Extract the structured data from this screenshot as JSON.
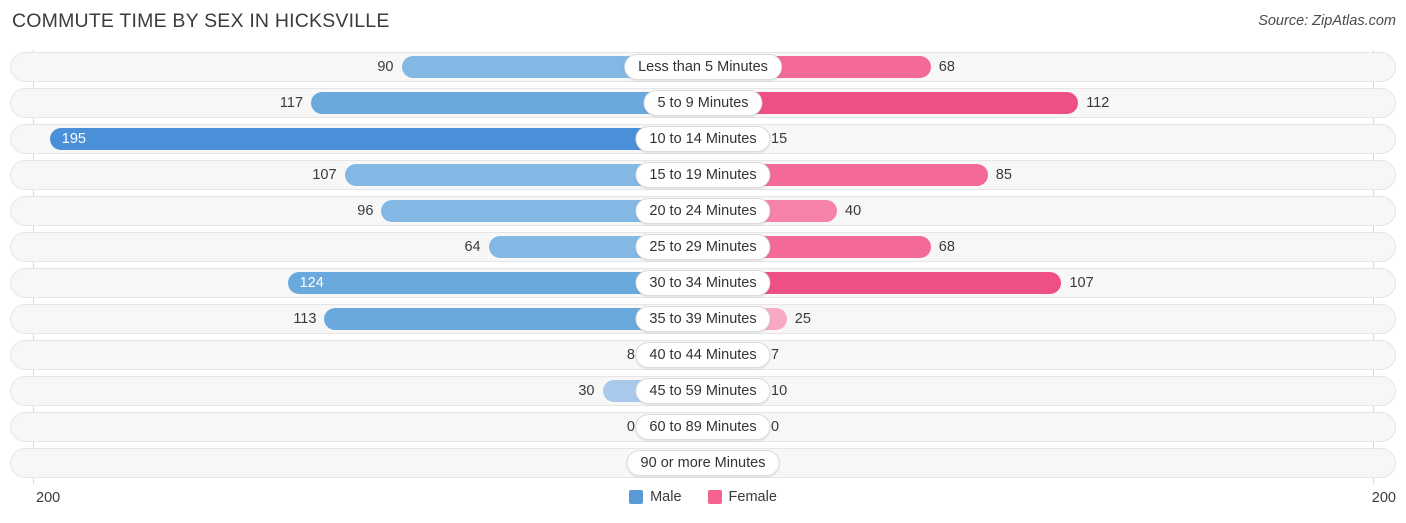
{
  "header": {
    "title": "COMMUTE TIME BY SEX IN HICKSVILLE",
    "source": "Source: ZipAtlas.com"
  },
  "axis": {
    "left_label": "200",
    "right_label": "200",
    "max": 200
  },
  "legend": {
    "items": [
      {
        "label": "Male",
        "color": "#5b9bd5"
      },
      {
        "label": "Female",
        "color": "#f2638f"
      }
    ]
  },
  "colors": {
    "male_max": "#4a90d9",
    "male_high": "#6aa9de",
    "male_mid": "#84b8e4",
    "male_low": "#a9c9ec",
    "female_max": "#ee4f84",
    "female_high": "#f2699a",
    "female_mid": "#f681aa",
    "female_low": "#f9a9c4",
    "track": "#f7f7f7",
    "track_border": "#e6e6e6",
    "axis": "#d8d8d8"
  },
  "chart_data": {
    "type": "bar",
    "orientation": "horizontal",
    "layout": "diverging-bidirectional",
    "title": "COMMUTE TIME BY SEX IN HICKSVILLE",
    "xlabel": "",
    "ylabel": "",
    "xlim": [
      200,
      200
    ],
    "grid": false,
    "legend_position": "bottom-center",
    "categories": [
      "Less than 5 Minutes",
      "5 to 9 Minutes",
      "10 to 14 Minutes",
      "15 to 19 Minutes",
      "20 to 24 Minutes",
      "25 to 29 Minutes",
      "30 to 34 Minutes",
      "35 to 39 Minutes",
      "40 to 44 Minutes",
      "45 to 59 Minutes",
      "60 to 89 Minutes",
      "90 or more Minutes"
    ],
    "series": [
      {
        "name": "Male",
        "side": "left",
        "color": "#5b9bd5",
        "values": [
          90,
          117,
          195,
          107,
          96,
          64,
          124,
          113,
          8,
          30,
          0,
          0
        ]
      },
      {
        "name": "Female",
        "side": "right",
        "color": "#f2638f",
        "values": [
          68,
          112,
          15,
          85,
          40,
          68,
          107,
          25,
          7,
          10,
          0,
          0
        ]
      }
    ]
  }
}
